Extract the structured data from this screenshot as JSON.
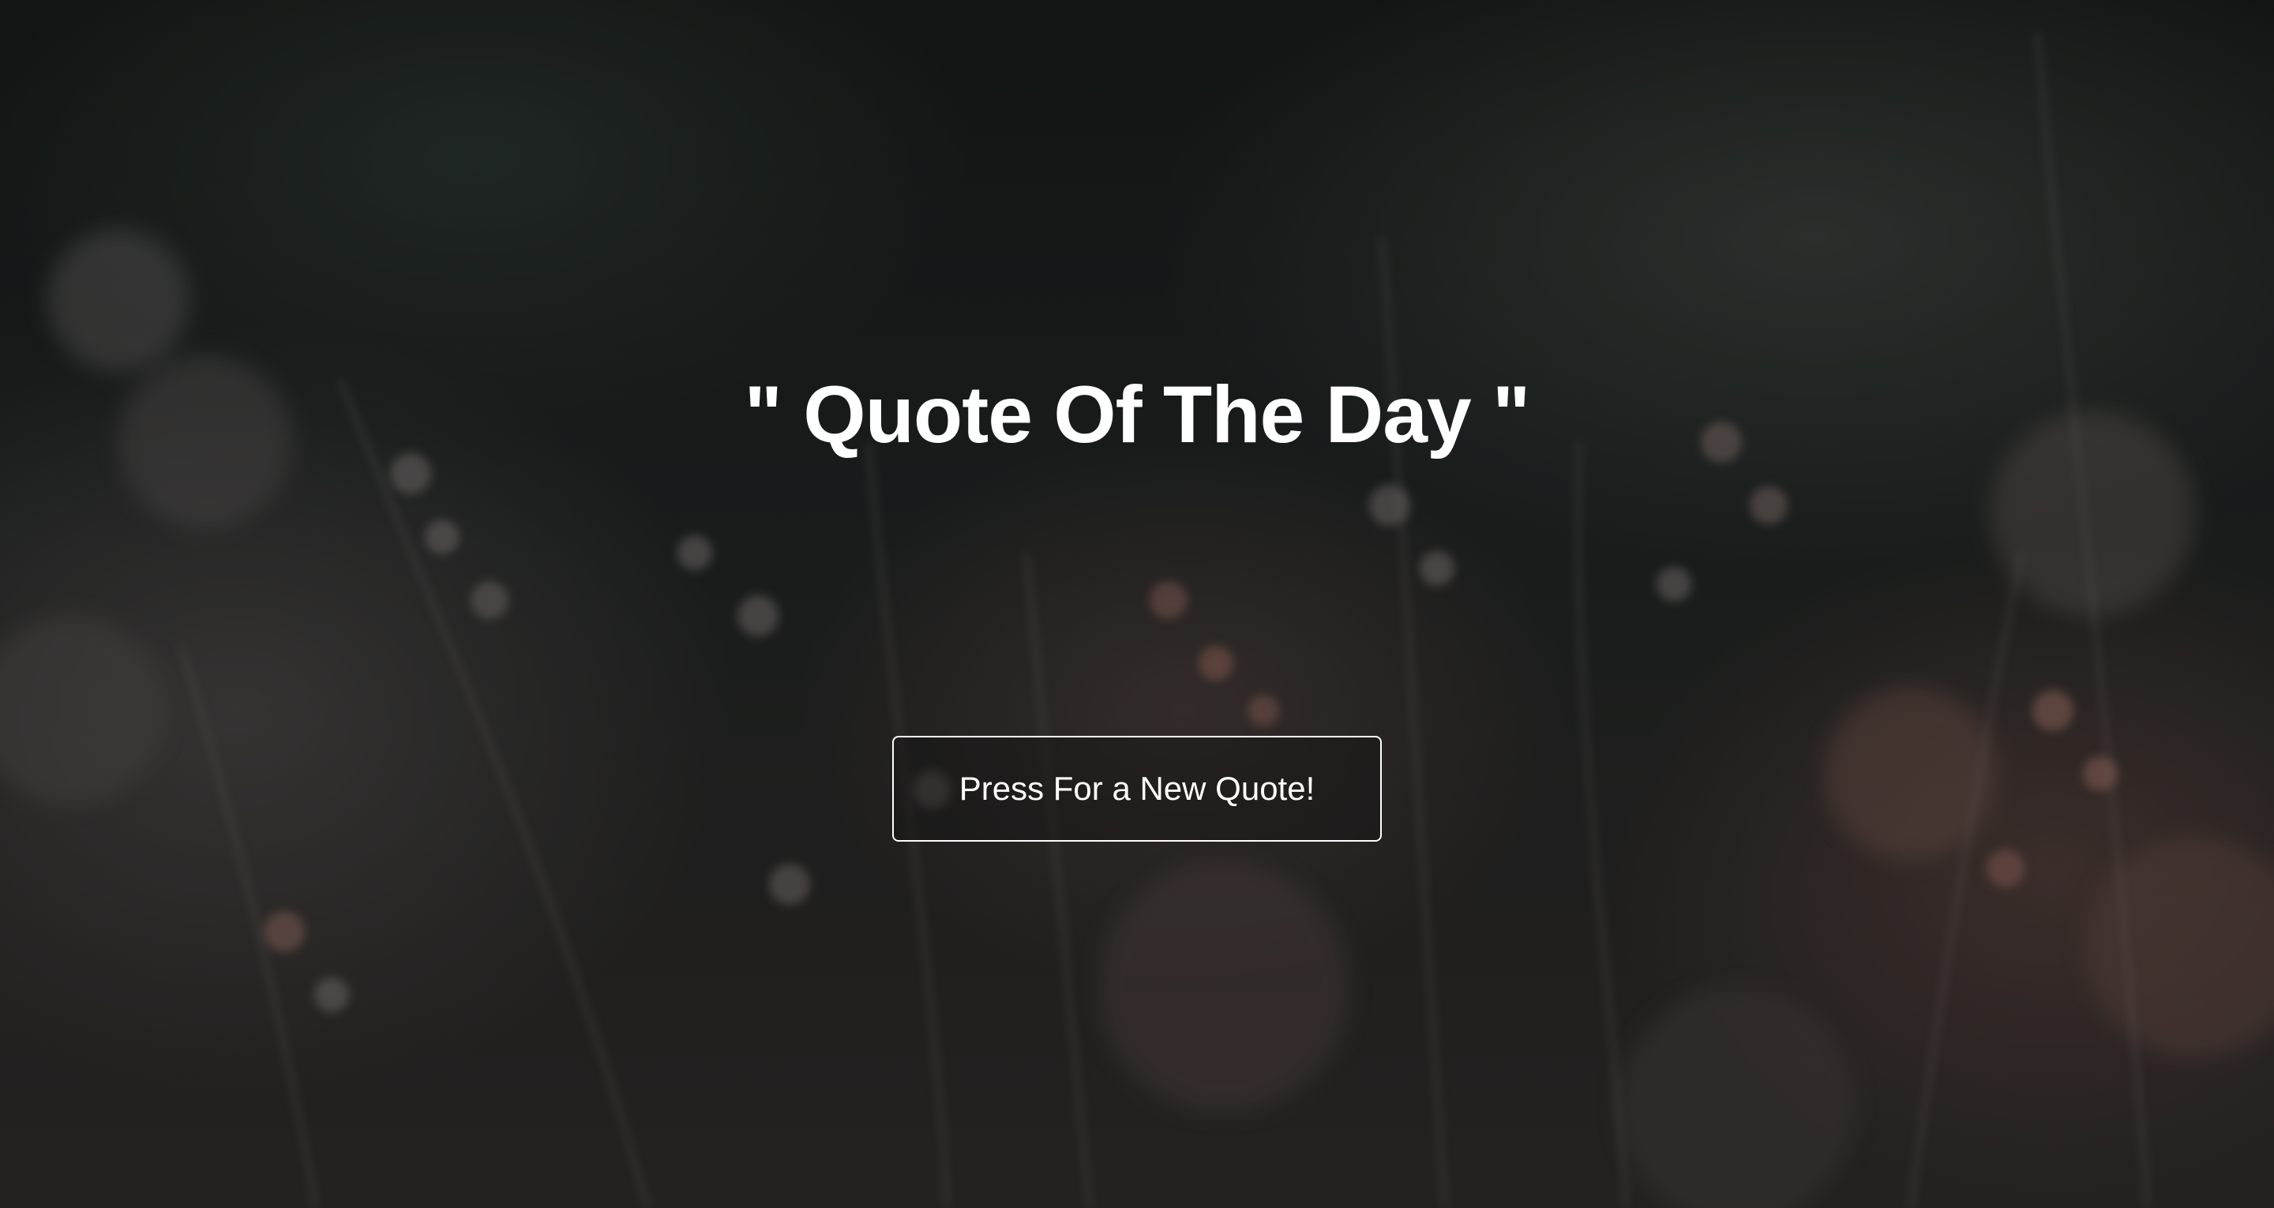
{
  "quote": {
    "title": "\" Quote Of The Day \""
  },
  "actions": {
    "new_quote_label": "Press For a New Quote!"
  },
  "colors": {
    "text": "#ffffff",
    "background": "#1a1e1c",
    "accent_flower": "#b07a6e"
  }
}
